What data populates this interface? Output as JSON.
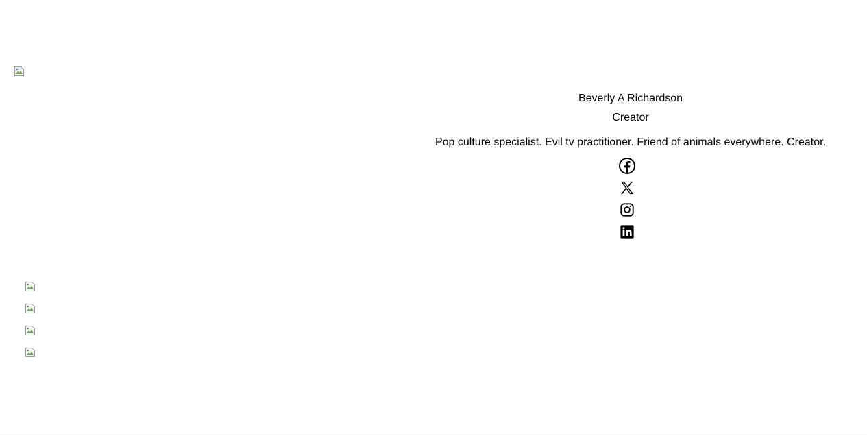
{
  "hero_image": {
    "icon": "broken-image-icon"
  },
  "thumbnails": [
    {
      "icon": "broken-image-icon"
    },
    {
      "icon": "broken-image-icon"
    },
    {
      "icon": "broken-image-icon"
    },
    {
      "icon": "broken-image-icon"
    }
  ],
  "profile": {
    "name": "Beverly A Richardson",
    "role": "Creator",
    "bio": "Pop culture specialist. Evil tv practitioner. Friend of animals everywhere. Creator."
  },
  "socials": [
    {
      "name": "Facebook",
      "icon": "facebook-icon"
    },
    {
      "name": "X",
      "icon": "x-icon"
    },
    {
      "name": "Instagram",
      "icon": "instagram-icon"
    },
    {
      "name": "LinkedIn",
      "icon": "linkedin-icon"
    }
  ],
  "colors": {
    "background": "#ffffff",
    "text": "#000000",
    "rule": "#8a8a8a"
  }
}
